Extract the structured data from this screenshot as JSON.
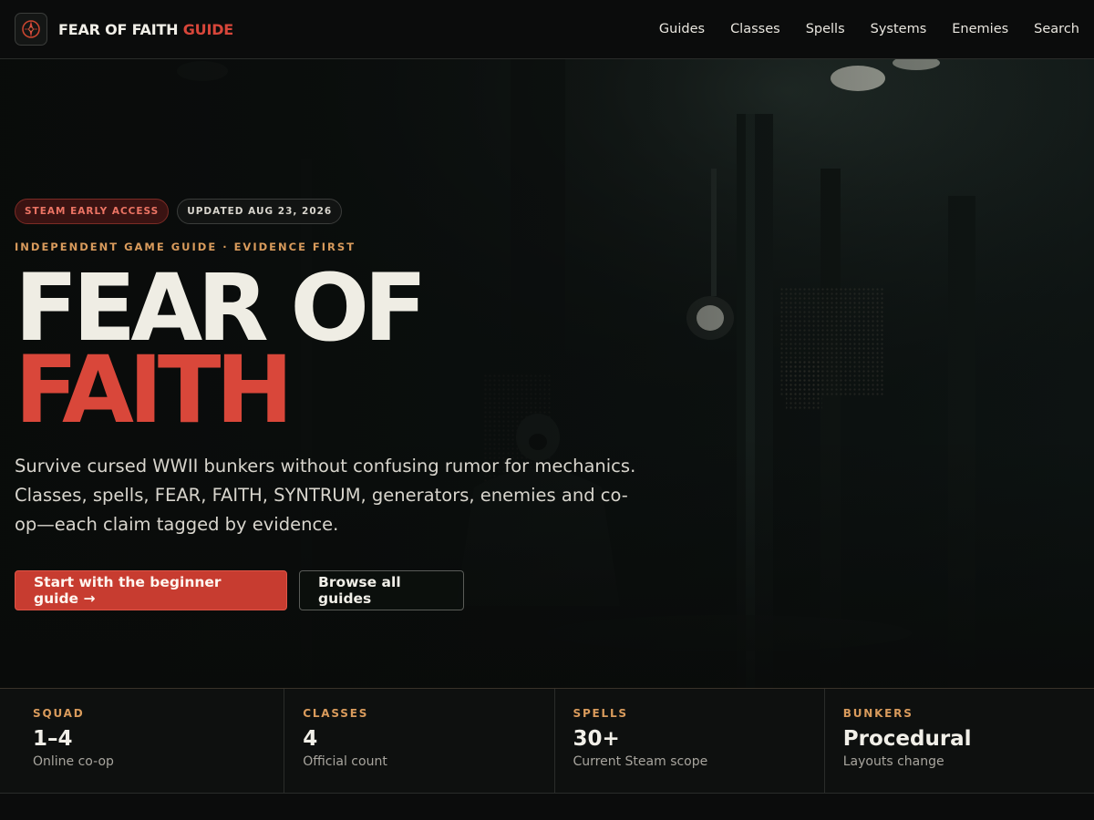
{
  "header": {
    "brand_main": "FEAR OF FAITH",
    "brand_accent": "GUIDE",
    "logo_icon": "candle-emblem-icon",
    "nav": [
      {
        "label": "Guides"
      },
      {
        "label": "Classes"
      },
      {
        "label": "Spells"
      },
      {
        "label": "Systems"
      },
      {
        "label": "Enemies"
      },
      {
        "label": "Search"
      }
    ]
  },
  "hero": {
    "badge_access": "STEAM EARLY ACCESS",
    "badge_updated": "UPDATED AUG 23, 2026",
    "kicker": "INDEPENDENT GAME GUIDE · EVIDENCE FIRST",
    "title_line1": "FEAR OF",
    "title_line2": "FAITH",
    "lead": "Survive cursed WWII bunkers without confusing rumor for mechanics. Classes, spells, FEAR, FAITH, SYNTRUM, generators, enemies and co-op—each claim tagged by evidence.",
    "primary_cta": "Start with the beginner guide →",
    "secondary_cta": "Browse all guides"
  },
  "stats": [
    {
      "label": "SQUAD",
      "value": "1–4",
      "note": "Online co-op"
    },
    {
      "label": "CLASSES",
      "value": "4",
      "note": "Official count"
    },
    {
      "label": "SPELLS",
      "value": "30+",
      "note": "Current Steam scope"
    },
    {
      "label": "BUNKERS",
      "value": "Procedural",
      "note": "Layouts change"
    }
  ],
  "colors": {
    "accent": "#d9473a",
    "kicker": "#d99b5c",
    "background": "#0b0d0c"
  }
}
